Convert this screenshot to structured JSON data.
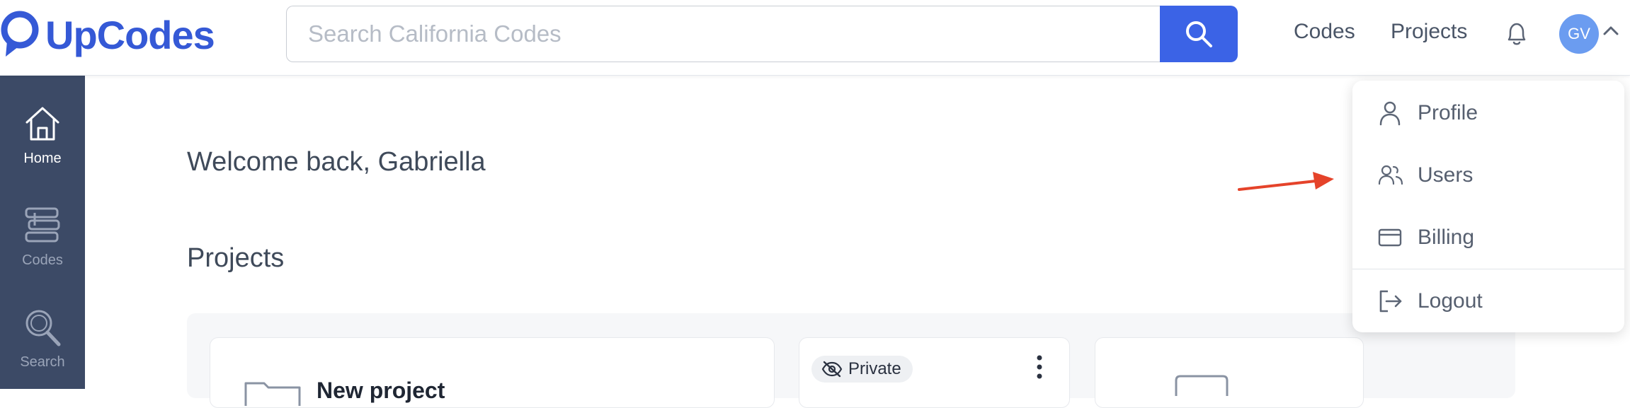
{
  "brand": {
    "name": "UpCodes",
    "color": "#3559d6"
  },
  "search": {
    "placeholder": "Search California Codes",
    "button_color": "#3b63e6"
  },
  "nav": {
    "codes": "Codes",
    "projects": "Projects"
  },
  "user": {
    "initials": "GV"
  },
  "sidebar": {
    "items": [
      {
        "label": "Home",
        "icon": "home-icon",
        "active": true
      },
      {
        "label": "Codes",
        "icon": "books-icon",
        "active": false
      },
      {
        "label": "Search",
        "icon": "search-icon",
        "active": false
      }
    ]
  },
  "main": {
    "welcome": "Welcome back, Gabriella",
    "projects_heading": "Projects",
    "cards": [
      {
        "title": "New project"
      },
      {
        "badge": "Private"
      }
    ]
  },
  "dropdown": {
    "items": [
      {
        "label": "Profile",
        "icon": "user-icon"
      },
      {
        "label": "Users",
        "icon": "users-icon"
      },
      {
        "label": "Billing",
        "icon": "credit-card-icon"
      },
      {
        "label": "Logout",
        "icon": "logout-icon"
      }
    ]
  },
  "annotation": {
    "arrow_color": "#e5432a"
  }
}
